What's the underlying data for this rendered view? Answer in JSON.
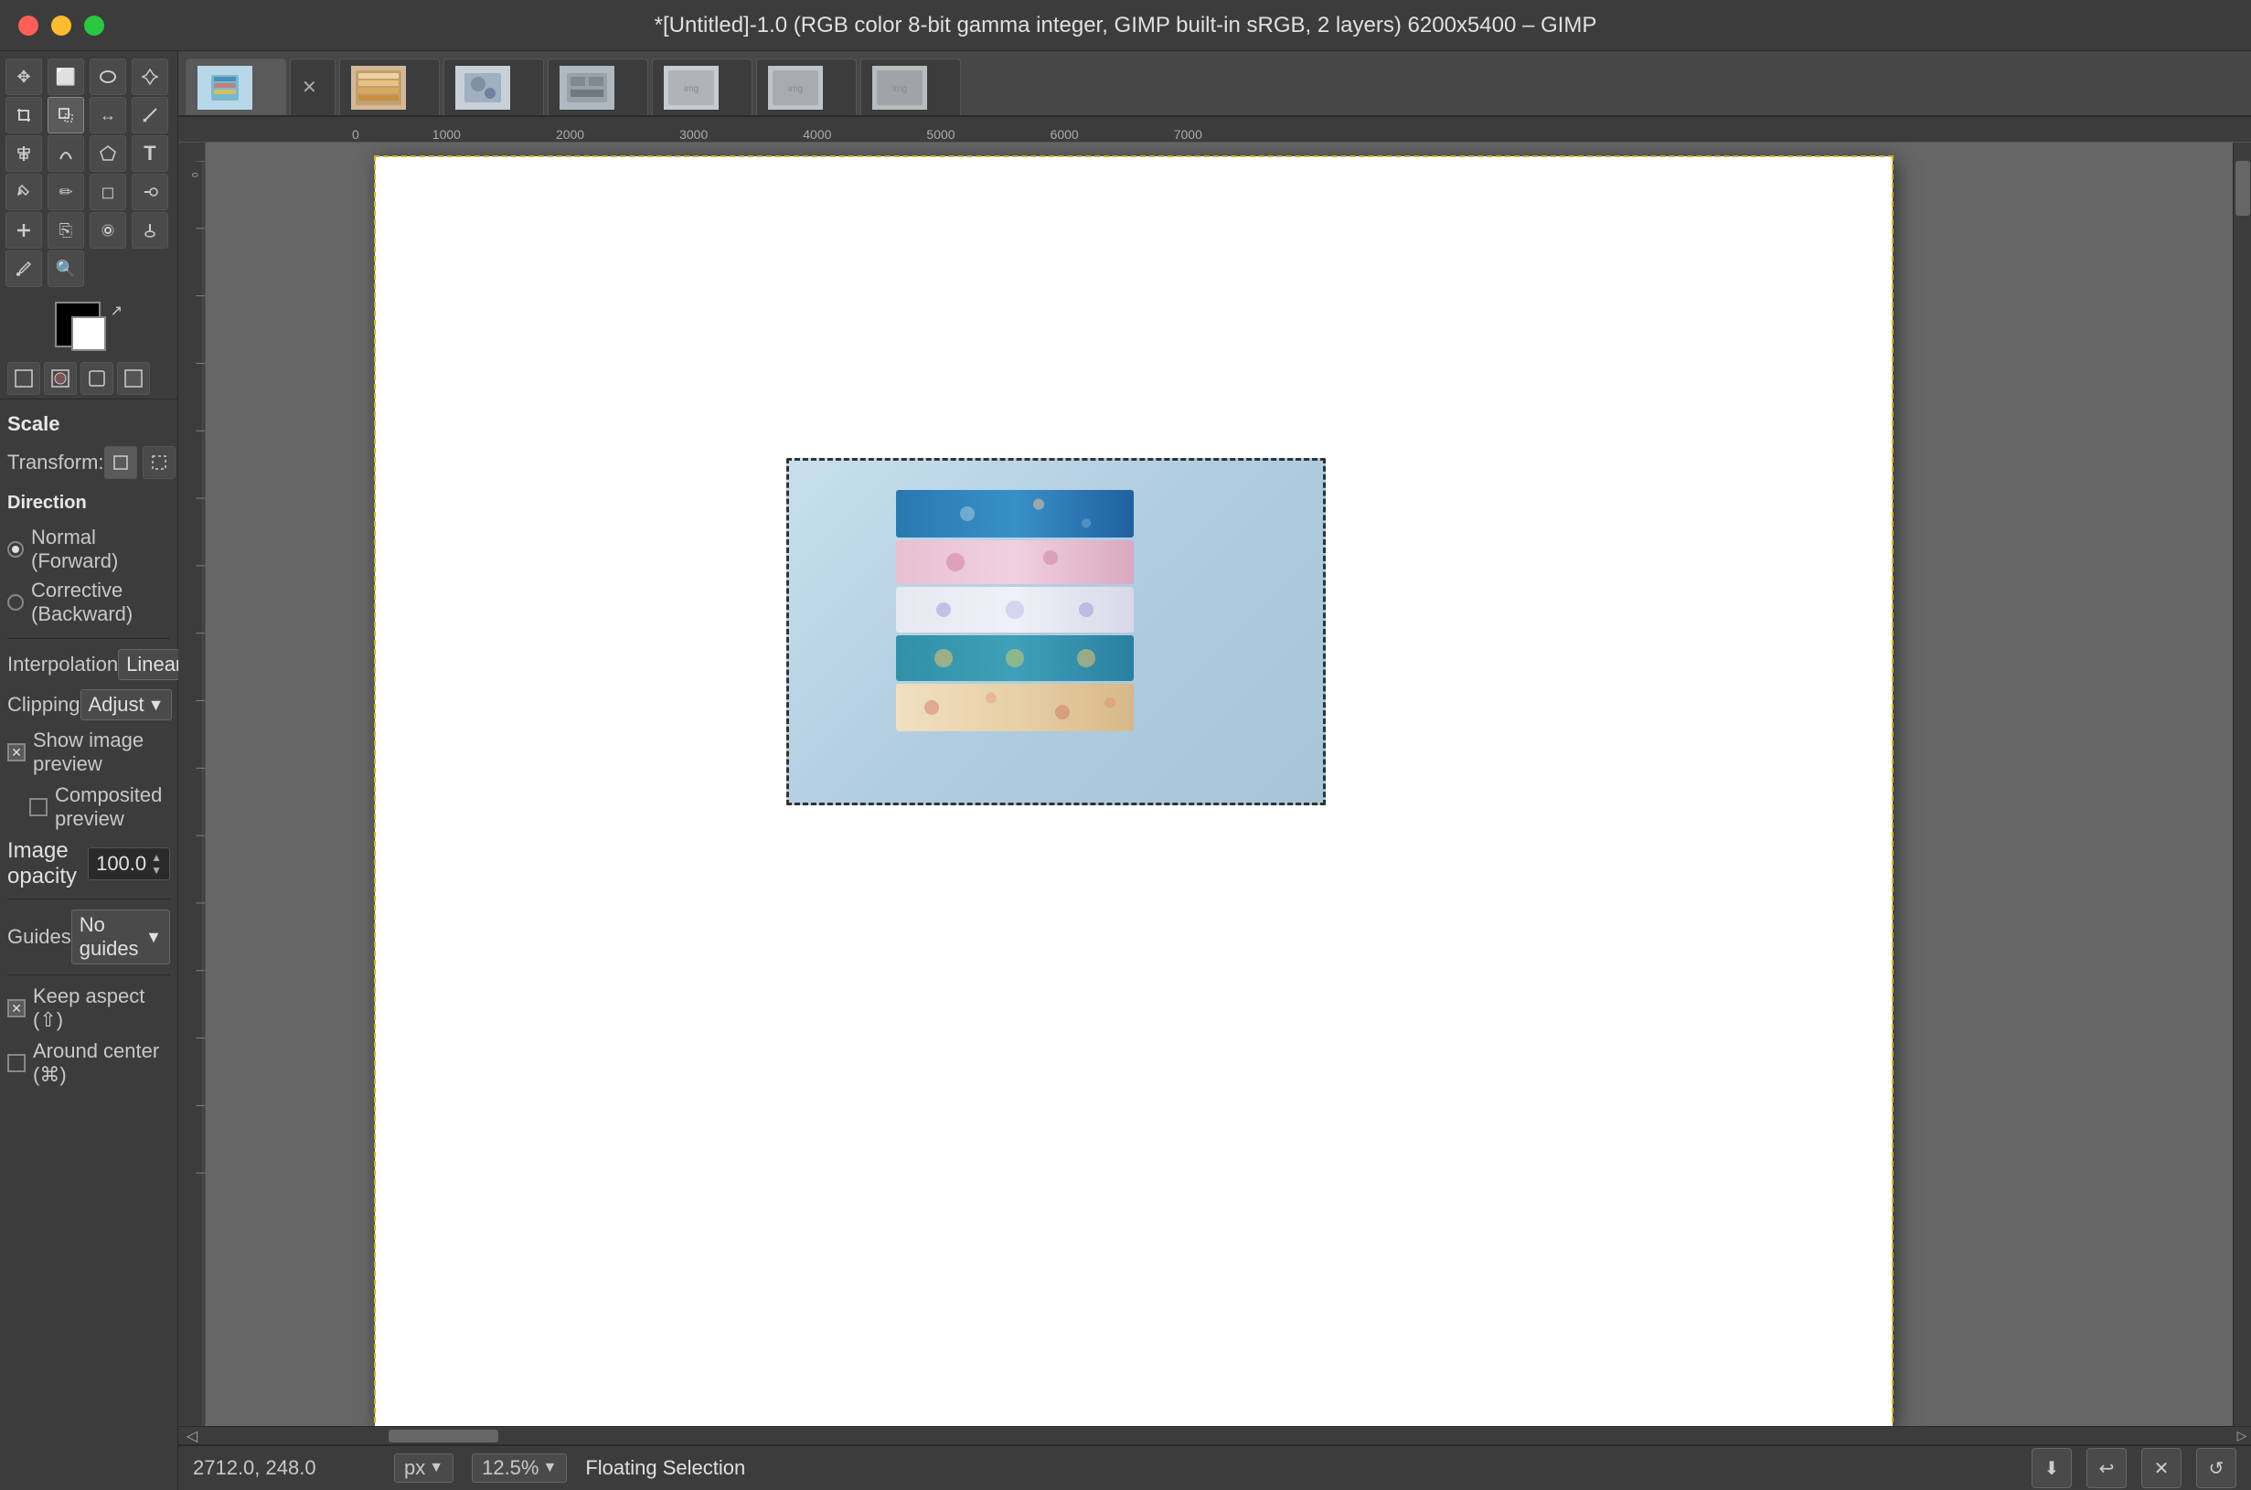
{
  "titlebar": {
    "title": "*[Untitled]-1.0 (RGB color 8-bit gamma integer, GIMP built-in sRGB, 2 layers) 6200x5400 – GIMP"
  },
  "toolbar": {
    "tools": [
      {
        "name": "move-tool",
        "icon": "✥"
      },
      {
        "name": "rect-select-tool",
        "icon": "⬜"
      },
      {
        "name": "lasso-tool",
        "icon": "○"
      },
      {
        "name": "fuzzy-select-tool",
        "icon": "⌖"
      },
      {
        "name": "crop-tool",
        "icon": "⧉"
      },
      {
        "name": "transform-tool",
        "icon": "↕",
        "active": true
      },
      {
        "name": "flip-tool",
        "icon": "⇌"
      },
      {
        "name": "measure-tool",
        "icon": "📏"
      },
      {
        "name": "text-tool",
        "icon": "T"
      },
      {
        "name": "fill-tool",
        "icon": "▣"
      },
      {
        "name": "eraser-tool",
        "icon": "◻"
      },
      {
        "name": "paint-tool",
        "icon": "✏"
      },
      {
        "name": "heal-tool",
        "icon": "✚"
      },
      {
        "name": "clone-tool",
        "icon": "⎘"
      },
      {
        "name": "blur-tool",
        "icon": "◎"
      },
      {
        "name": "dodge-tool",
        "icon": "☀"
      }
    ]
  },
  "tool_options": {
    "title": "Scale",
    "transform_label": "Transform:",
    "direction_label": "Direction",
    "direction_options": [
      {
        "label": "Normal (Forward)",
        "checked": true
      },
      {
        "label": "Corrective (Backward)",
        "checked": false
      }
    ],
    "interpolation_label": "Interpolation",
    "interpolation_value": "Linear",
    "clipping_label": "Clipping",
    "clipping_value": "Adjust",
    "show_image_preview": {
      "label": "Show image preview",
      "checked": true
    },
    "composited_preview": {
      "label": "Composited preview",
      "checked": false
    },
    "image_opacity": {
      "label": "Image opacity",
      "value": "100.0"
    },
    "guides_label": "Guides",
    "guides_value": "No guides",
    "keep_aspect": {
      "label": "Keep aspect (⇧)",
      "checked": true
    },
    "around_center": {
      "label": "Around center (⌘)",
      "checked": false
    }
  },
  "tabs": [
    {
      "id": "tab-active",
      "label": "",
      "active": true,
      "img_class": "tab-img-1"
    },
    {
      "id": "tab-close",
      "label": "✕",
      "active": false
    },
    {
      "id": "tab-2",
      "label": "",
      "active": false,
      "img_class": "tab-img-2"
    },
    {
      "id": "tab-3",
      "label": "",
      "active": false,
      "img_class": "tab-img-3"
    },
    {
      "id": "tab-4",
      "label": "",
      "active": false,
      "img_class": "tab-img-4"
    },
    {
      "id": "tab-5",
      "label": "",
      "active": false,
      "img_class": "tab-img-5"
    },
    {
      "id": "tab-6",
      "label": "",
      "active": false,
      "img_class": "tab-img-6"
    },
    {
      "id": "tab-7",
      "label": "",
      "active": false,
      "img_class": "tab-img-7"
    }
  ],
  "ruler": {
    "ticks": [
      "0",
      "1000",
      "2000",
      "3000",
      "4000",
      "5000",
      "6000",
      "7000"
    ]
  },
  "status_bar": {
    "coords": "2712.0, 248.0",
    "unit": "px",
    "zoom": "12.5%",
    "selection": "Floating Selection"
  },
  "bottom_toolbar": {
    "save_icon": "⬇",
    "undo_icon": "↩",
    "cancel_icon": "✕",
    "redo_icon": "↺"
  }
}
